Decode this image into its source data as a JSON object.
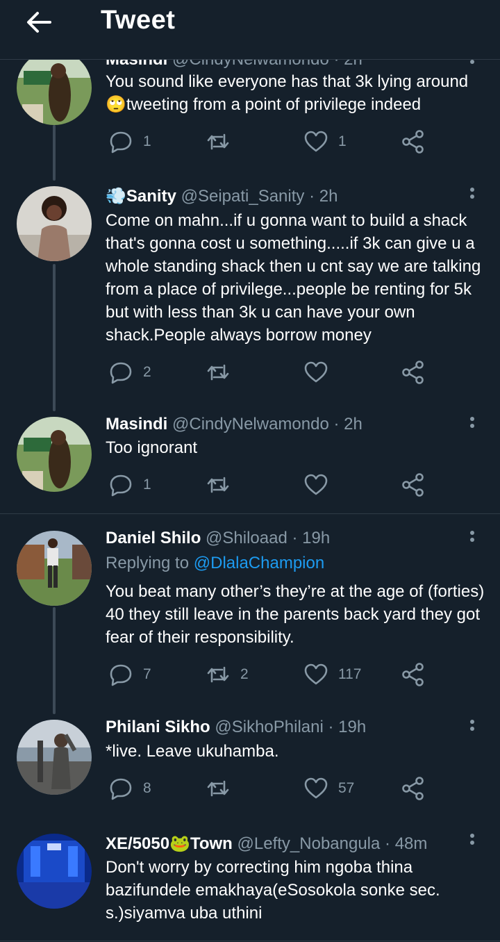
{
  "header": {
    "title": "Tweet",
    "back_icon": "arrow-left-icon"
  },
  "tweets": [
    {
      "name": "Masindi",
      "handle": "@CindyNelwamondo",
      "time": "· 2h",
      "text": "You sound like everyone has that 3k lying around 🙄tweeting from a point of privilege indeed",
      "replies": "1",
      "retweets": "",
      "likes": "1"
    },
    {
      "name_emoji": "💨",
      "name": "Sanity",
      "handle": "@Seipati_Sanity",
      "time": "· 2h",
      "text": "Come on mahn...if u gonna want to build a shack that's gonna cost u something.....if 3k can give u a whole standing shack then u cnt say  we are talking from a place of privilege...people be renting for 5k but with less than 3k u can have your own shack.People always borrow money",
      "replies": "2",
      "retweets": "",
      "likes": ""
    },
    {
      "name": "Masindi",
      "handle": "@CindyNelwamondo",
      "time": "· 2h",
      "text": "Too ignorant",
      "replies": "1",
      "retweets": "",
      "likes": ""
    },
    {
      "name": "Daniel Shilo",
      "handle": "@Shiloaad",
      "time": "· 19h",
      "replying_prefix": "Replying to ",
      "replying_to": "@DlalaChampion",
      "text": "You beat many other’s they’re at the age of (forties) 40 they still leave in the parents back yard they got fear of their responsibility.",
      "replies": "7",
      "retweets": "2",
      "likes": "117"
    },
    {
      "name": "Philani Sikho",
      "handle": "@SikhoPhilani",
      "time": "· 19h",
      "text": "*live. Leave ukuhamba.",
      "replies": "8",
      "retweets": "",
      "likes": "57"
    },
    {
      "name_a": "XE/5050",
      "name_emoji": "🐸",
      "name_b": "Town",
      "handle": "@Lefty_Nobangula",
      "time": "· 48m",
      "text": "Don't worry by correcting him ngoba thina bazifundele emakhaya(eSosokola sonke sec. s.)siyamva uba uthini",
      "replies": "",
      "retweets": "",
      "likes": ""
    }
  ],
  "colors": {
    "background": "#15202b",
    "secondary_text": "#8899a6",
    "link": "#1d9bf0",
    "divider": "#2f3b47"
  }
}
